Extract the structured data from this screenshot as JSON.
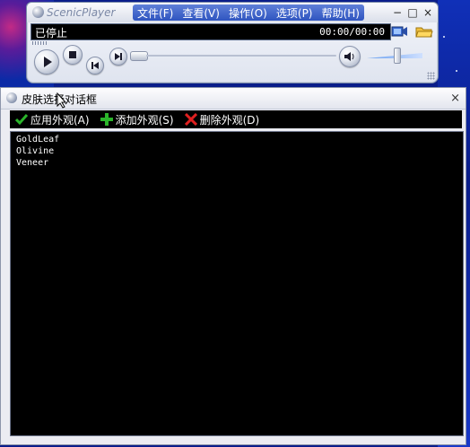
{
  "player": {
    "name": "ScenicPlayer",
    "menu": [
      "文件(F)",
      "查看(V)",
      "操作(O)",
      "选项(P)",
      "帮助(H)"
    ],
    "window_buttons": [
      "−",
      "□",
      "×"
    ],
    "status": "已停止",
    "time": "00:00/00:00"
  },
  "dialog": {
    "title": "皮肤选择对话框",
    "close": "×",
    "toolbar": {
      "apply": "应用外观(A)",
      "add": "添加外观(S)",
      "delete": "删除外观(D)"
    },
    "skins": [
      "GoldLeaf",
      "Olivine",
      "Veneer"
    ]
  },
  "colors": {
    "menu_bar": "#2f55c0",
    "apply_icon": "#2bb52b",
    "add_icon": "#2bb52b",
    "delete_icon": "#e02020"
  },
  "icons": {
    "play": "play-icon",
    "stop": "stop-icon",
    "prev": "previous-icon",
    "next": "next-icon",
    "volume": "speaker-icon",
    "video": "video-icon",
    "open": "folder-icon"
  }
}
